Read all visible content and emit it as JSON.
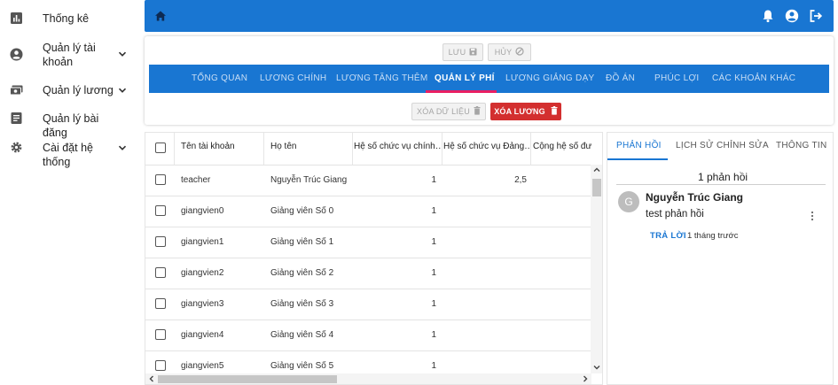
{
  "sidebar": {
    "items": [
      {
        "label": "Thống kê",
        "icon": "bar-chart-icon"
      },
      {
        "label": "Quản lý tài khoản",
        "icon": "account-circle-icon"
      },
      {
        "label": "Quản lý lương",
        "icon": "payments-icon"
      },
      {
        "label": "Quản lý bài đăng",
        "icon": "article-icon"
      },
      {
        "label": "Cài đặt hệ thống",
        "icon": "gear-icon"
      }
    ]
  },
  "topbar": {
    "icons": [
      "home-icon",
      "bell-icon",
      "account-icon",
      "logout-icon"
    ],
    "color": "#1976d2"
  },
  "toolbar": {
    "save_label": "LƯU",
    "cancel_label": "HỦY",
    "delete_data_label": "XÓA DỮ LIỆU",
    "delete_salary_label": "XÓA LƯƠNG",
    "delete_salary_color": "#d32f2f"
  },
  "tabs": [
    {
      "label": "TỔNG QUAN"
    },
    {
      "label": "LƯƠNG CHÍNH"
    },
    {
      "label": "LƯƠNG TĂNG THÊM"
    },
    {
      "label": "QUẢN LÝ PHÍ",
      "active": true
    },
    {
      "label": "LƯƠNG GIẢNG DẠY"
    },
    {
      "label": "ĐỒ ÁN"
    },
    {
      "label": "PHÚC LỢI"
    },
    {
      "label": "CÁC KHOẢN KHÁC"
    }
  ],
  "table": {
    "headers": [
      "Tên tài khoản",
      "Họ tên",
      "Hệ số chức vụ chính…",
      "Hệ số chức vụ Đảng…",
      "Cộng hệ số được h"
    ],
    "rows": [
      {
        "account": "teacher",
        "name": "Nguyễn Trúc Giang",
        "c1": "1",
        "c2": "2,5"
      },
      {
        "account": "giangvien0",
        "name": "Giảng viên Số 0",
        "c1": "1",
        "c2": ""
      },
      {
        "account": "giangvien1",
        "name": "Giảng viên Số 1",
        "c1": "1",
        "c2": ""
      },
      {
        "account": "giangvien2",
        "name": "Giảng viên Số 2",
        "c1": "1",
        "c2": ""
      },
      {
        "account": "giangvien3",
        "name": "Giảng viên Số 3",
        "c1": "1",
        "c2": ""
      },
      {
        "account": "giangvien4",
        "name": "Giảng viên Số 4",
        "c1": "1",
        "c2": ""
      },
      {
        "account": "giangvien5",
        "name": "Giảng viên Số 5",
        "c1": "1",
        "c2": ""
      }
    ]
  },
  "right_panel": {
    "tabs": [
      {
        "label": "PHẢN HỒI",
        "active": true
      },
      {
        "label": "LỊCH SỬ CHỈNH SỬA"
      },
      {
        "label": "THÔNG TIN"
      }
    ],
    "count_label": "1 phản hồi",
    "comment": {
      "avatar_letter": "G",
      "author": "Nguyễn Trúc Giang",
      "text": "test phản hồi",
      "reply_label": "TRẢ LỜI",
      "time": "1 tháng trước"
    }
  }
}
